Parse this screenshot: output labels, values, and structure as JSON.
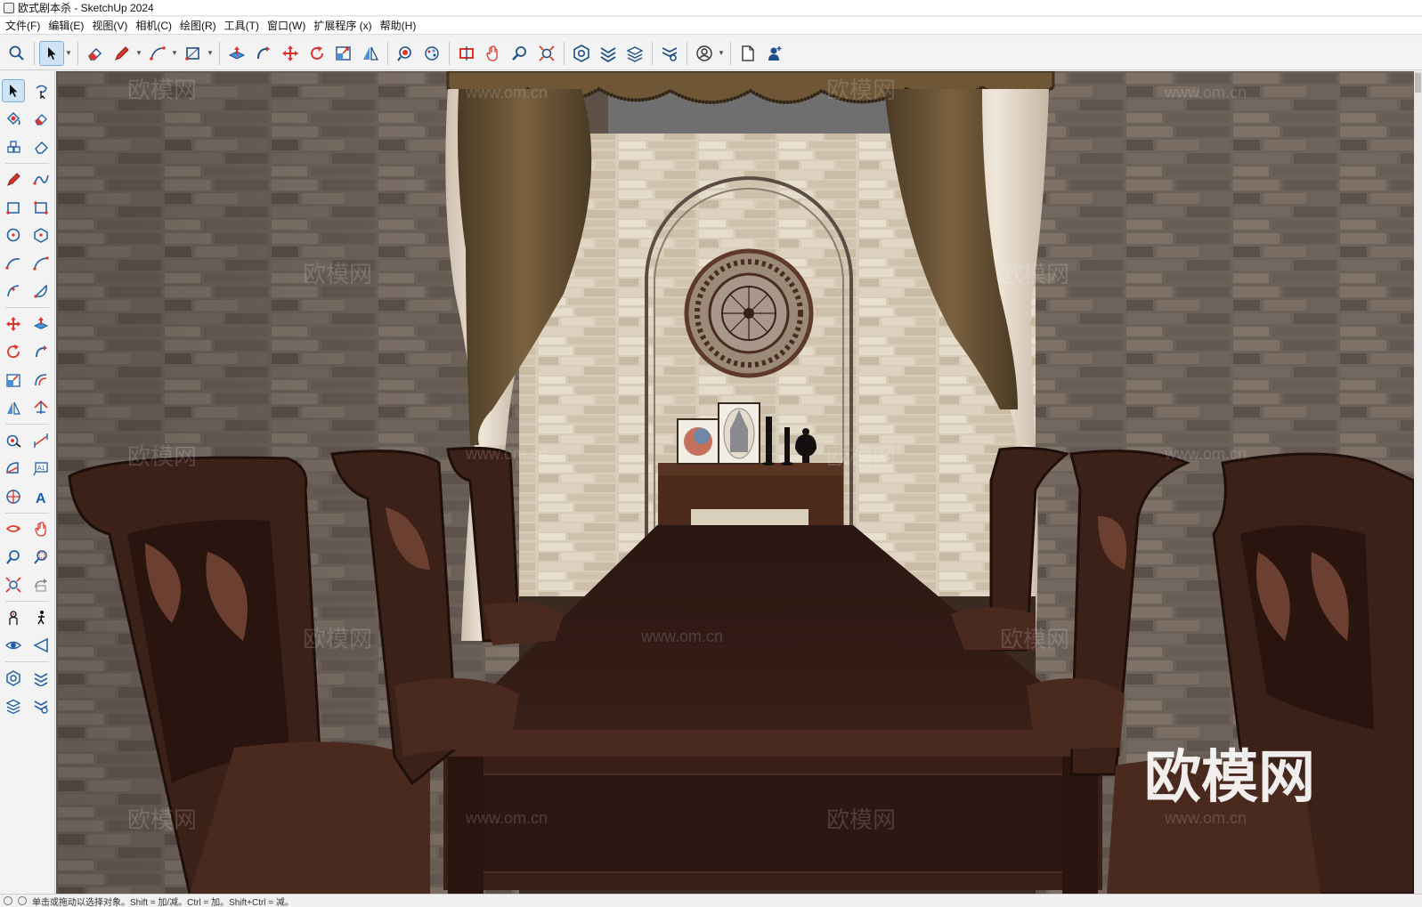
{
  "window": {
    "title": "欧式剧本杀 - SketchUp 2024"
  },
  "menu": [
    {
      "label": "文件(F)"
    },
    {
      "label": "编辑(E)"
    },
    {
      "label": "视图(V)"
    },
    {
      "label": "相机(C)"
    },
    {
      "label": "绘图(R)"
    },
    {
      "label": "工具(T)"
    },
    {
      "label": "窗口(W)"
    },
    {
      "label": "扩展程序 (x)"
    },
    {
      "label": "帮助(H)"
    }
  ],
  "toolbar": {
    "active_tool": "select",
    "icons": [
      "search-icon",
      "select-arrow-icon",
      "eraser-icon",
      "pencil-icon",
      "line-icon",
      "rectangle-icon",
      "push-pull-icon",
      "follow-me-icon",
      "move-icon",
      "rotate-icon",
      "scale-icon",
      "flip-icon",
      "paint-icon",
      "materials-icon",
      "section-plane-icon",
      "orbit-icon",
      "zoom-icon",
      "zoom-extents-icon",
      "warehouse-icon",
      "extension-warehouse-icon",
      "layers-icon",
      "settings-icon",
      "account-icon",
      "new-file-icon",
      "add-user-icon"
    ]
  },
  "left_toolbar": {
    "rows": [
      [
        "select-icon",
        "lasso-icon"
      ],
      [
        "paint-bucket-icon",
        "eraser-icon"
      ],
      [
        "component-icon",
        "tag-eraser-icon"
      ],
      [
        "pencil-icon",
        "freehand-icon"
      ],
      [
        "rectangle-icon",
        "rotated-rectangle-icon"
      ],
      [
        "circle-icon",
        "polygon-icon"
      ],
      [
        "arc-icon",
        "two-point-arc-icon"
      ],
      [
        "three-point-arc-icon",
        "pie-icon"
      ],
      [
        "move-icon",
        "push-pull-icon"
      ],
      [
        "rotate-icon",
        "follow-me-icon"
      ],
      [
        "scale-icon",
        "offset-icon"
      ],
      [
        "flip-icon",
        "mirror-icon"
      ],
      [
        "tape-measure-icon",
        "dimension-icon"
      ],
      [
        "protractor-icon",
        "text-label-icon"
      ],
      [
        "axes-icon",
        "3d-text-icon"
      ],
      [
        "orbit-icon",
        "pan-icon"
      ],
      [
        "zoom-icon",
        "zoom-window-icon"
      ],
      [
        "zoom-extents-icon",
        "previous-view-icon"
      ],
      [
        "position-camera-icon",
        "walk-icon"
      ],
      [
        "look-around-icon",
        "section-icon"
      ],
      [
        "warehouse-icon",
        "extension-icon"
      ],
      [
        "layers-icon",
        "extension-settings-icon"
      ]
    ]
  },
  "viewport": {
    "watermark_large": "欧模网",
    "watermark_small": "www.om.cn",
    "watermark_logo": "欧模网"
  },
  "status": {
    "text": "单击或拖动以选择对象。Shift = 加/减。Ctrl = 加。Shift+Ctrl = 减。"
  },
  "colors": {
    "accent": "#1a6fc7",
    "icon_red": "#e0342b",
    "icon_blue": "#1f5fa8",
    "wall": "#6b6058",
    "wood": "#3b1f17"
  }
}
